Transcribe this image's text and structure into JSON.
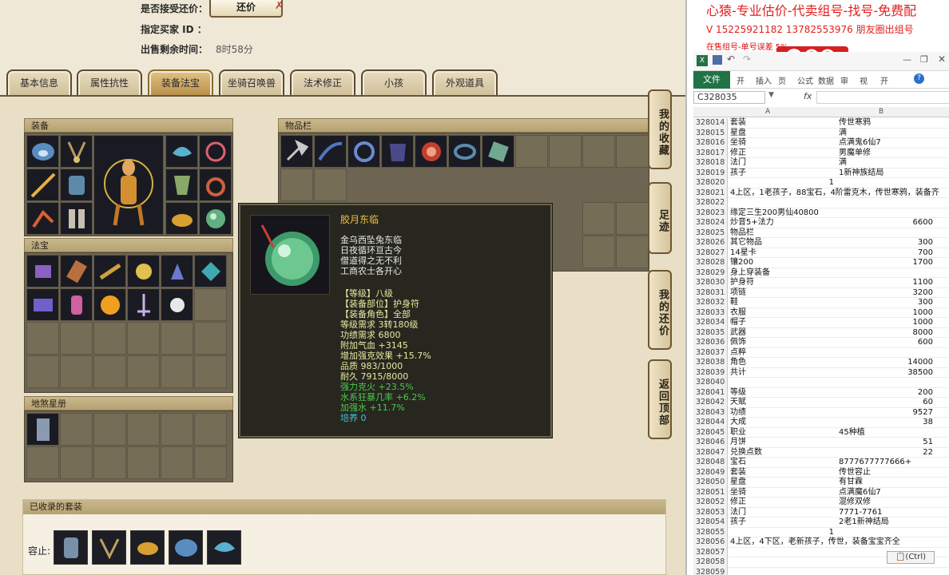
{
  "header": {
    "accept_haggle_label": "是否接受还价：",
    "haggle_button": "还价",
    "buyer_id_label": "指定买家 ID ：",
    "time_left_label": "出售剩余时间：",
    "time_left_value": "8时58分"
  },
  "tabs": [
    "基本信息",
    "属性抗性",
    "装备法宝",
    "坐骑召唤兽",
    "法术修正",
    "小孩",
    "外观道具"
  ],
  "sections": {
    "equipment": "装备",
    "inventory": "物品栏",
    "treasure": "法宝",
    "earth_star": "地煞星册",
    "collected_suits": "已收录的套装",
    "suit_label": "容止:"
  },
  "side_buttons": [
    "我的收藏",
    "足迹",
    "我的还价",
    "返回顶部"
  ],
  "tooltip": {
    "name": "胶月东临",
    "desc": [
      "金乌西坠兔东临",
      "日夜循环亘古今",
      "僧道得之无不利",
      "工商农士各开心"
    ],
    "stats": [
      {
        "text": "【等级】八级",
        "color": "#e8e8a0"
      },
      {
        "text": "【装备部位】护身符",
        "color": "#e8e8a0"
      },
      {
        "text": "【装备角色】全部",
        "color": "#e8e8a0"
      },
      {
        "text": "等级需求 3转180级",
        "color": "#e8e8a0"
      },
      {
        "text": "功绩需求 6800",
        "color": "#e8e8a0"
      },
      {
        "text": "附加气血 +3145",
        "color": "#e8e8a0"
      },
      {
        "text": "增加强克效果 +15.7%",
        "color": "#e8e8a0"
      },
      {
        "text": "品质 983/1000",
        "color": "#e8e8a0"
      },
      {
        "text": "耐久 7915/8000",
        "color": "#e8e8a0"
      },
      {
        "text": "强力克火 +23.5%",
        "color": "#4cc94c"
      },
      {
        "text": "水系狂暴几率 +6.2%",
        "color": "#4cc94c"
      },
      {
        "text": "加强水 +11.7%",
        "color": "#4cc94c"
      },
      {
        "text": "培养 0",
        "color": "#38c8e0"
      }
    ]
  },
  "excel": {
    "ad_title": "心猿-专业估价-代卖组号-找号-免费配",
    "ad_phone": "V 15225921182   13782553976 朋友圈出组号",
    "ad_line3": "在售组号-单号误差 5%",
    "file_tab": "文件",
    "ribbon_tabs": [
      "开",
      "插入",
      "页",
      "公式",
      "数据",
      "审",
      "视",
      "开"
    ],
    "name_box": "C328035",
    "fx": "fx",
    "col_a": "A",
    "col_b": "B",
    "paste_label": "(Ctrl)",
    "rows": [
      {
        "n": "328014",
        "a": "套装",
        "b": "传世寒鸦"
      },
      {
        "n": "328015",
        "a": "星盘",
        "b": "满"
      },
      {
        "n": "328016",
        "a": "坐骑",
        "b": "点满鬼6仙7"
      },
      {
        "n": "328017",
        "a": "修正",
        "b": "男魔单修"
      },
      {
        "n": "328018",
        "a": "法门",
        "b": "满"
      },
      {
        "n": "328019",
        "a": "孩子",
        "b": "1新神族结局"
      },
      {
        "n": "328020",
        "a": "1",
        "b": "",
        "a_right": true
      },
      {
        "n": "328021",
        "a": "4上区，1老孩子，88宝石，4阶雷克木，传世寒鸦，装备齐",
        "b": ""
      },
      {
        "n": "328022",
        "a": "",
        "b": ""
      },
      {
        "n": "328023",
        "a": "缘定三生200男仙40800",
        "b": ""
      },
      {
        "n": "328024",
        "a": "炒音5+法力",
        "b": "6600",
        "num": true
      },
      {
        "n": "328025",
        "a": "物品栏",
        "b": ""
      },
      {
        "n": "328026",
        "a": "其它物品",
        "b": "300",
        "num": true
      },
      {
        "n": "328027",
        "a": "14星卡",
        "b": "700",
        "num": true
      },
      {
        "n": "328028",
        "a": "镶200",
        "b": "1700",
        "num": true
      },
      {
        "n": "328029",
        "a": "身上穿装备",
        "b": ""
      },
      {
        "n": "328030",
        "a": "护身符",
        "b": "1100",
        "num": true
      },
      {
        "n": "328031",
        "a": "项链",
        "b": "3200",
        "num": true
      },
      {
        "n": "328032",
        "a": "鞋",
        "b": "300",
        "num": true
      },
      {
        "n": "328033",
        "a": "衣服",
        "b": "1000",
        "num": true
      },
      {
        "n": "328034",
        "a": "帽子",
        "b": "1000",
        "num": true
      },
      {
        "n": "328035",
        "a": "武器",
        "b": "8000",
        "num": true
      },
      {
        "n": "328036",
        "a": "佩饰",
        "b": "600",
        "num": true
      },
      {
        "n": "328037",
        "a": "点粹",
        "b": ""
      },
      {
        "n": "328038",
        "a": "角色",
        "b": "14000",
        "num": true
      },
      {
        "n": "328039",
        "a": "共计",
        "b": "38500",
        "num": true
      },
      {
        "n": "328040",
        "a": "",
        "b": ""
      },
      {
        "n": "328041",
        "a": "等级",
        "b": "200",
        "num": true
      },
      {
        "n": "328042",
        "a": "天赋",
        "b": "60",
        "num": true
      },
      {
        "n": "328043",
        "a": "功绩",
        "b": "9527",
        "num": true
      },
      {
        "n": "328044",
        "a": "大成",
        "b": "38",
        "num": true
      },
      {
        "n": "328045",
        "a": "职业",
        "b": "45种植"
      },
      {
        "n": "328046",
        "a": "月饼",
        "b": "51",
        "num": true
      },
      {
        "n": "328047",
        "a": "兑换点数",
        "b": "22",
        "num": true
      },
      {
        "n": "328048",
        "a": "宝石",
        "b": "8777677777666+"
      },
      {
        "n": "328049",
        "a": "套装",
        "b": "传世容止"
      },
      {
        "n": "328050",
        "a": "星盘",
        "b": "有甘霖"
      },
      {
        "n": "328051",
        "a": "坐骑",
        "b": "点满魔6仙7"
      },
      {
        "n": "328052",
        "a": "修正",
        "b": "混修双修"
      },
      {
        "n": "328053",
        "a": "法门",
        "b": "7771-7761"
      },
      {
        "n": "328054",
        "a": "孩子",
        "b": "2老1新神结局"
      },
      {
        "n": "328055",
        "a": "1",
        "b": "",
        "a_right": true
      },
      {
        "n": "328056",
        "a": "4上区，4下区，老新孩子，传世，装备宝宝齐全",
        "b": ""
      },
      {
        "n": "328057",
        "a": "",
        "b": ""
      },
      {
        "n": "328058",
        "a": "",
        "b": ""
      },
      {
        "n": "328059",
        "a": "",
        "b": ""
      }
    ]
  }
}
